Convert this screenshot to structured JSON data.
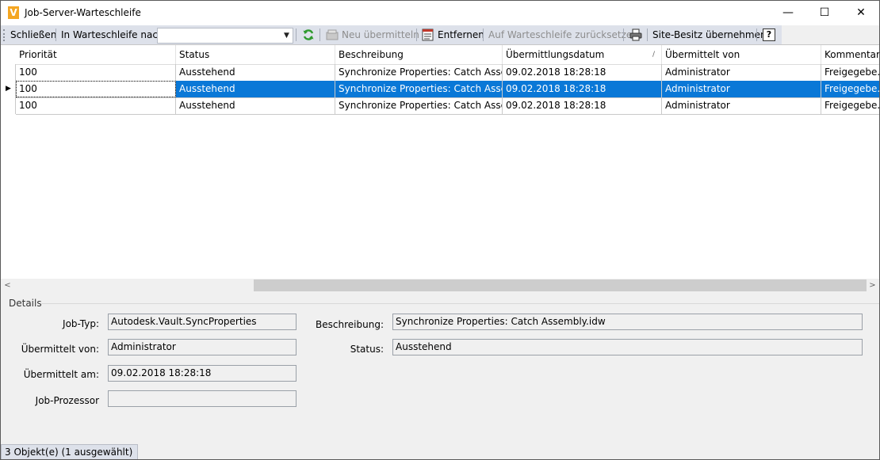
{
  "window": {
    "title": "Job-Server-Warteschleife",
    "app_icon": "V",
    "minimize": "—",
    "maximize": "☐",
    "close": "✕"
  },
  "toolbar": {
    "close_label": "Schließen",
    "queue_label": "In Warteschleife nach:",
    "queue_value": "",
    "resubmit_label": "Neu übermitteln",
    "remove_label": "Entfernen",
    "requeue_label": "Auf Warteschleife zurücksetzen",
    "site_ownership_label": "Site-Besitz übernehmen",
    "help_label": "?"
  },
  "grid": {
    "columns": [
      "Priorität",
      "Status",
      "Beschreibung",
      "Übermittlungsdatum",
      "Übermittelt von",
      "Kommentar"
    ],
    "sort_indicator": "/",
    "rows": [
      {
        "priority": "100",
        "status": "Ausstehend",
        "description": "Synchronize Properties: Catch Assem...",
        "date": "09.02.2018 18:28:18",
        "by": "Administrator",
        "comment": "Freigegebe..."
      },
      {
        "priority": "100",
        "status": "Ausstehend",
        "description": "Synchronize Properties: Catch Assem...",
        "date": "09.02.2018 18:28:18",
        "by": "Administrator",
        "comment": "Freigegebe..."
      },
      {
        "priority": "100",
        "status": "Ausstehend",
        "description": "Synchronize Properties: Catch Assem...",
        "date": "09.02.2018 18:28:18",
        "by": "Administrator",
        "comment": "Freigegebe..."
      }
    ],
    "selected_row_index": 1,
    "row_indicator": "▶"
  },
  "details": {
    "title": "Details",
    "job_type_label": "Job-Typ:",
    "job_type_value": "Autodesk.Vault.SyncProperties",
    "submitted_by_label": "Übermittelt von:",
    "submitted_by_value": "Administrator",
    "submitted_on_label": "Übermittelt am:",
    "submitted_on_value": "09.02.2018 18:28:18",
    "processor_label": "Job-Prozessor",
    "processor_value": "",
    "description_label": "Beschreibung:",
    "description_value": "Synchronize Properties: Catch Assembly.idw",
    "status_label": "Status:",
    "status_value": "Ausstehend"
  },
  "statusbar": {
    "text": "3 Objekt(e) (1 ausgewählt)"
  },
  "colors": {
    "selection": "#0a78d7",
    "toolbar_bg": "#dde1ea",
    "refresh_icon": "#2e9a2e",
    "app_icon": "#f4a622"
  },
  "icons": [
    "app-logo-icon",
    "refresh-icon",
    "resubmit-icon",
    "remove-icon",
    "print-icon",
    "help-icon",
    "dropdown-arrow-icon",
    "row-indicator-icon",
    "scroll-left-icon",
    "scroll-right-icon"
  ]
}
